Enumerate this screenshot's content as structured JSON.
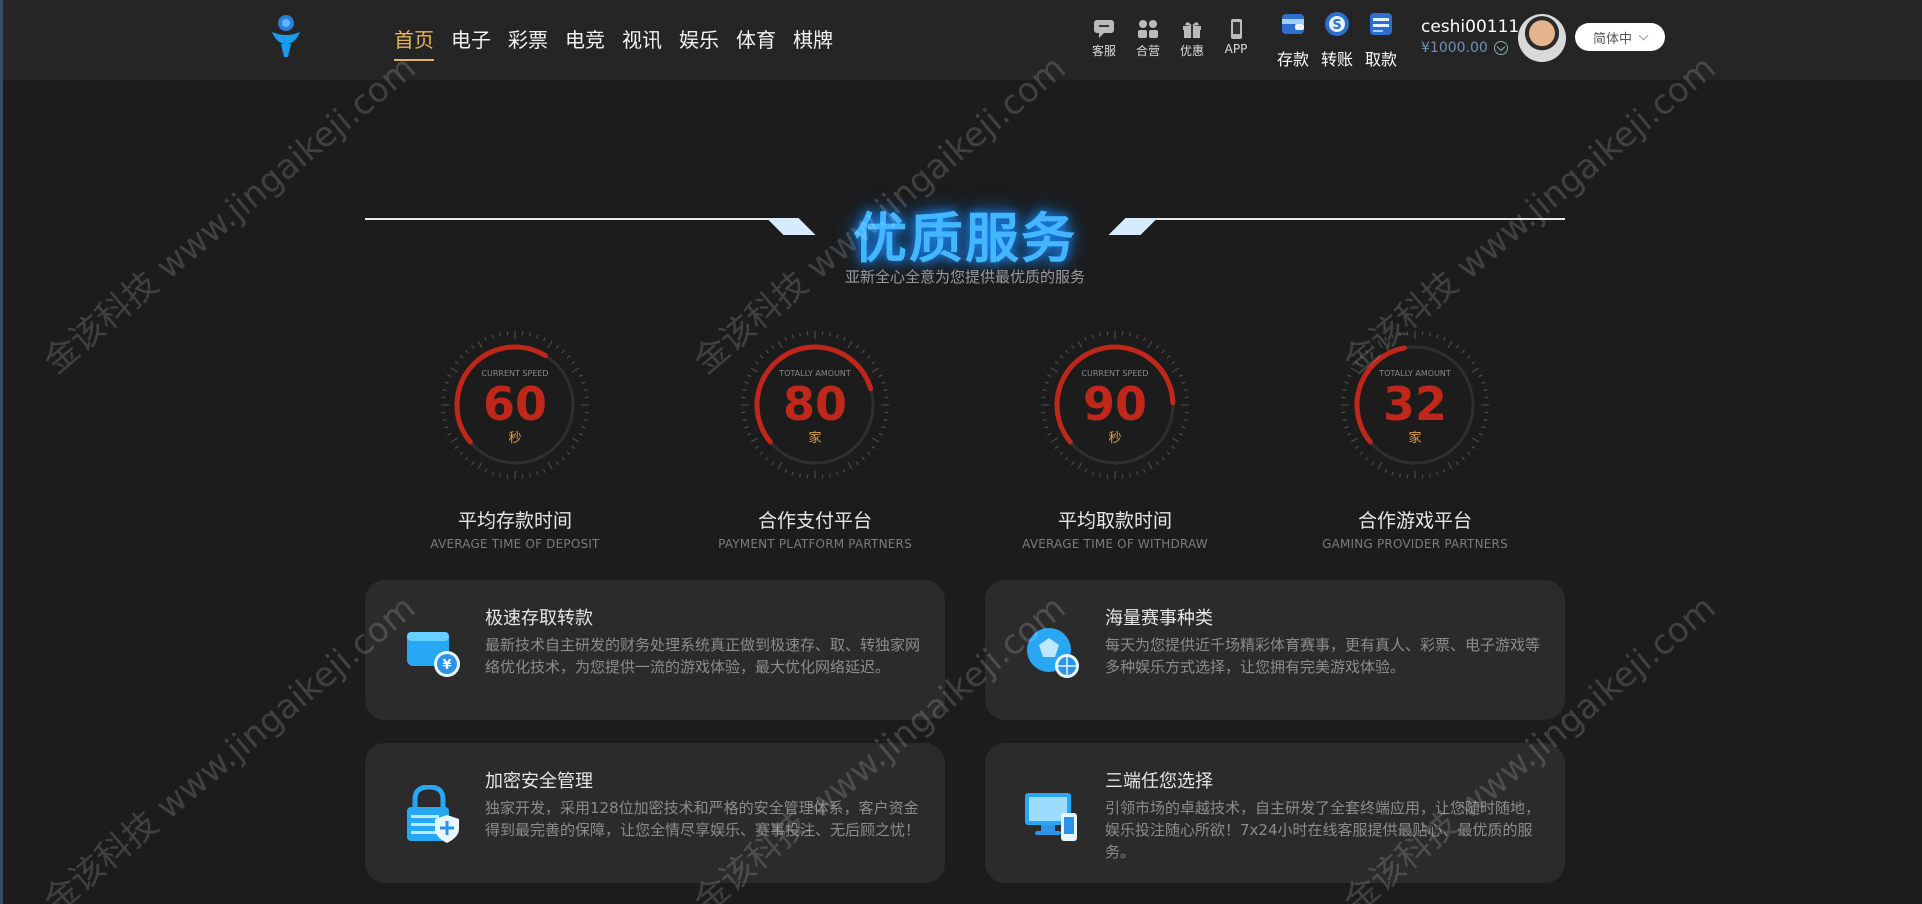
{
  "header": {
    "nav": [
      "首页",
      "电子",
      "彩票",
      "电竞",
      "视讯",
      "娱乐",
      "体育",
      "棋牌"
    ],
    "tools": [
      {
        "label": "客服",
        "icon": "chat-icon"
      },
      {
        "label": "合营",
        "icon": "partners-icon"
      },
      {
        "label": "优惠",
        "icon": "gift-icon"
      },
      {
        "label": "APP",
        "icon": "phone-icon"
      }
    ],
    "funds": [
      {
        "label": "存款",
        "icon": "deposit-icon"
      },
      {
        "label": "转账",
        "icon": "transfer-icon"
      },
      {
        "label": "取款",
        "icon": "withdraw-icon"
      }
    ],
    "username": "ceshi00111",
    "balance": "¥1000.00",
    "language": "简体中"
  },
  "section": {
    "title": "优质服务",
    "subtitle": "亚新全心全意为您提供最优质的服务"
  },
  "gauges": [
    {
      "caption": "CURRENT SPEED",
      "value": "60",
      "unit": "秒",
      "label": "平均存款时间",
      "sub": "AVERAGE TIME OF DEPOSIT",
      "fill": 0.35
    },
    {
      "caption": "TOTALLY AMOUNT",
      "value": "80",
      "unit": "家",
      "label": "合作支付平台",
      "sub": "PAYMENT PLATFORM PARTNERS",
      "fill": 0.5
    },
    {
      "caption": "CURRENT SPEED",
      "value": "90",
      "unit": "秒",
      "label": "平均取款时间",
      "sub": "AVERAGE TIME OF WITHDRAW",
      "fill": 0.55
    },
    {
      "caption": "TOTALLY AMOUNT",
      "value": "32",
      "unit": "家",
      "label": "合作游戏平台",
      "sub": "GAMING PROVIDER PARTNERS",
      "fill": 0.2
    }
  ],
  "features": [
    {
      "title": "极速存取转款",
      "text": "最新技术自主研发的财务处理系统真正做到极速存、取、转独家网络优化技术，为您提供一流的游戏体验，最大优化网络延迟。",
      "icon": "wallet-icon"
    },
    {
      "title": "海量赛事种类",
      "text": "每天为您提供近千场精彩体育赛事，更有真人、彩票、电子游戏等多种娱乐方式选择，让您拥有完美游戏体验。",
      "icon": "sports-ball-icon"
    },
    {
      "title": "加密安全管理",
      "text": "独家开发，采用128位加密技术和严格的安全管理体系，客户资金得到最完善的保障，让您全情尽享娱乐、赛事投注、无后顾之忧！",
      "icon": "lock-icon"
    },
    {
      "title": "三端任您选择",
      "text": "引领市场的卓越技术，自主研发了全套终端应用，让您随时随地，娱乐投注随心所欲！7x24小时在线客服提供最贴心、最优质的服务。",
      "icon": "devices-icon"
    }
  ],
  "watermark": "金该科技 www.jingaikeji.com",
  "colors": {
    "accent": "#e6b45c",
    "title_blue": "#43b6ff",
    "gauge_red": "#c0271b"
  }
}
